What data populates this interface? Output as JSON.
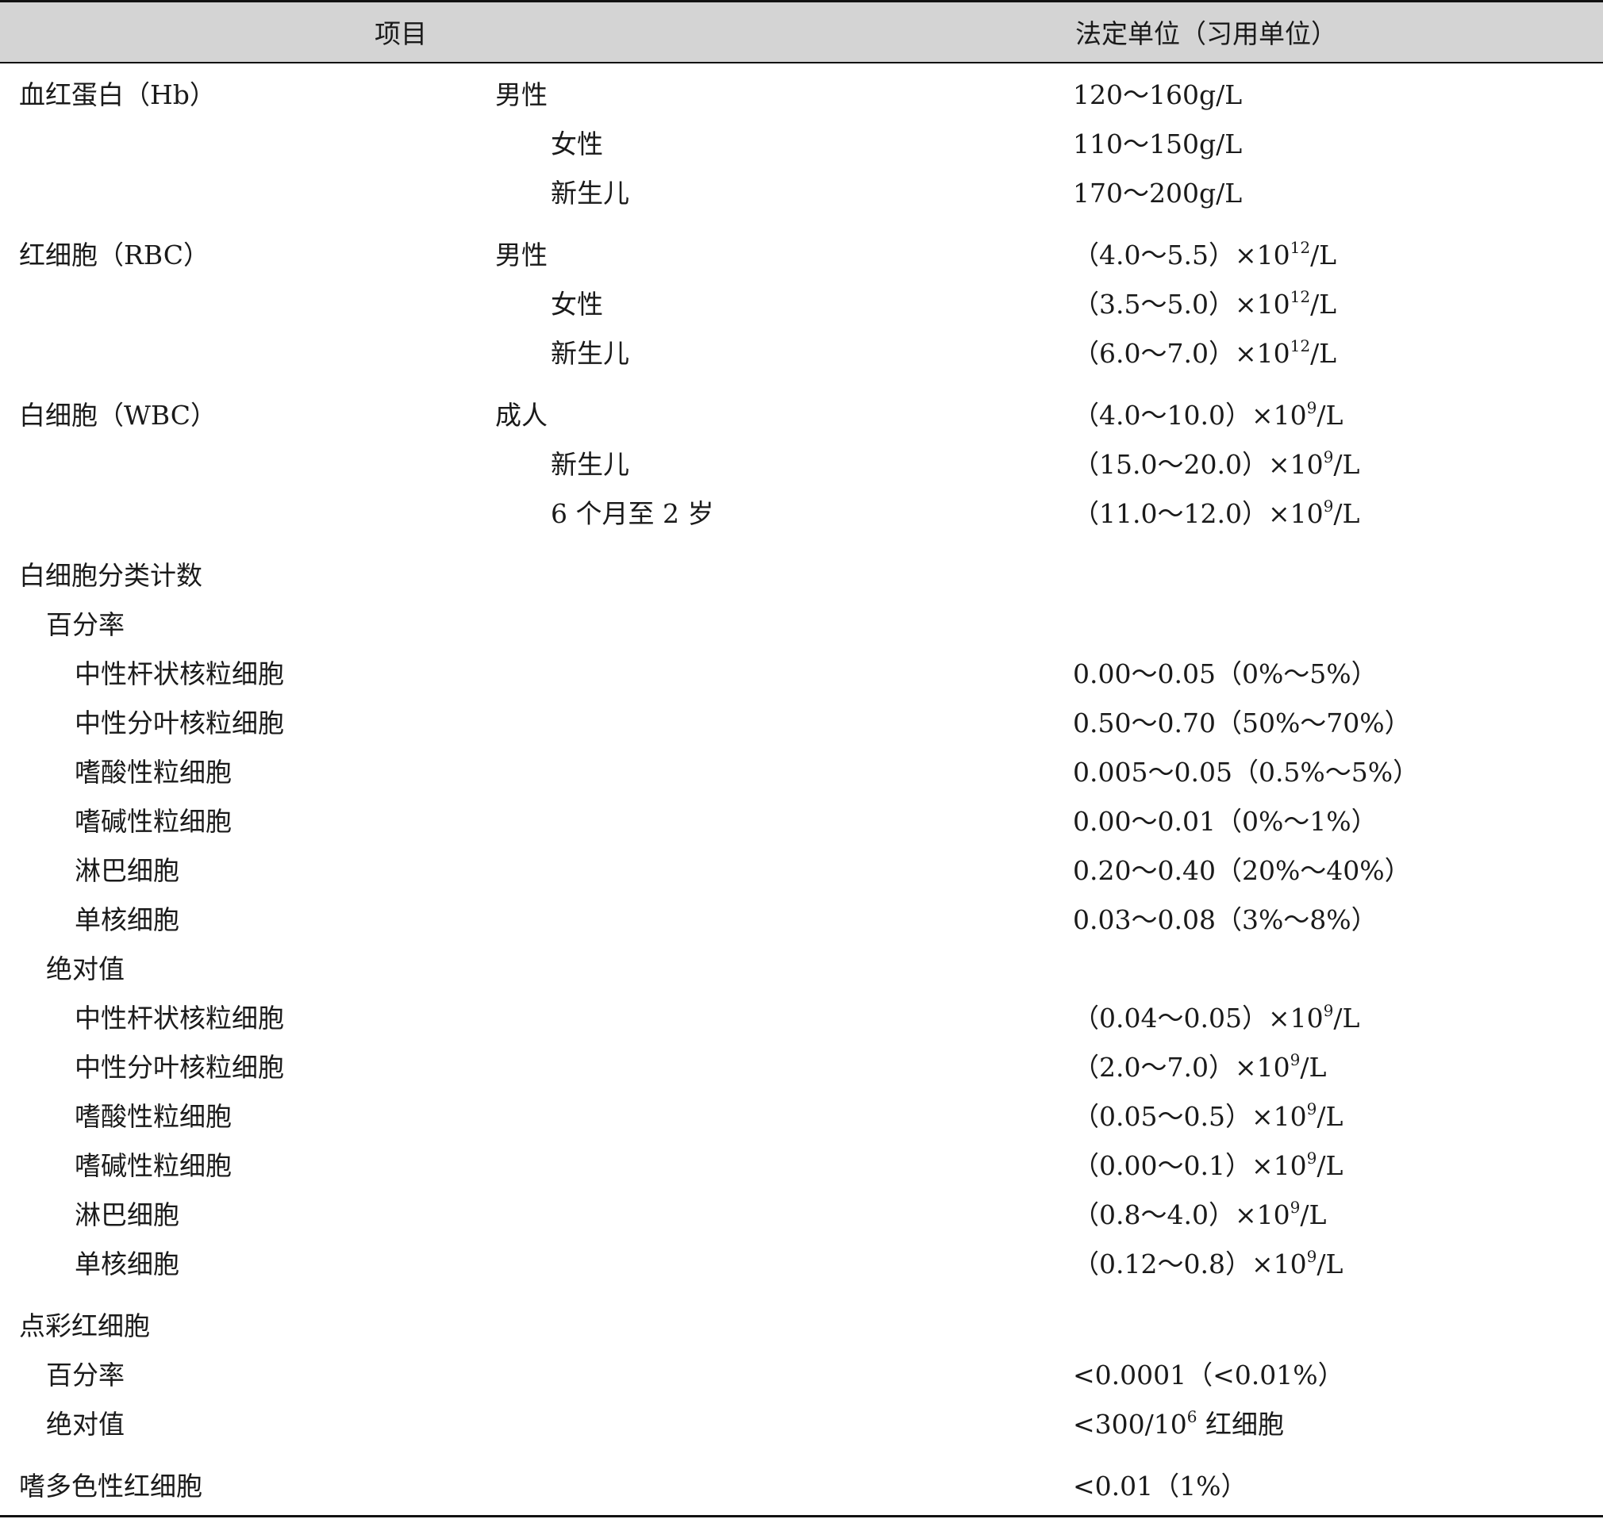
{
  "header": {
    "col_item": "项目",
    "col_unit": "法定单位（习用单位）"
  },
  "rows": [
    {
      "name": "血红蛋白（Hb）",
      "sub": "男性",
      "value": "120～160g/L"
    },
    {
      "name": "",
      "sub": "女性",
      "value": "110～150g/L"
    },
    {
      "name": "",
      "sub": "新生儿",
      "value": "170～200g/L"
    },
    {
      "name": "红细胞（RBC）",
      "sub": "男性",
      "value": "（4.0～5.5）×10",
      "exp": "12",
      "unit": "/L"
    },
    {
      "name": "",
      "sub": "女性",
      "value": "（3.5～5.0）×10",
      "exp": "12",
      "unit": "/L"
    },
    {
      "name": "",
      "sub": "新生儿",
      "value": "（6.0～7.0）×10",
      "exp": "12",
      "unit": "/L"
    },
    {
      "name": "白细胞（WBC）",
      "sub": "成人",
      "value": "（4.0～10.0）×10",
      "exp": "9",
      "unit": "/L"
    },
    {
      "name": "",
      "sub": "新生儿",
      "value": "（15.0～20.0）×10",
      "exp": "9",
      "unit": "/L"
    },
    {
      "name": "",
      "sub": "6 个月至 2 岁",
      "value": "（11.0～12.0）×10",
      "exp": "9",
      "unit": "/L"
    },
    {
      "name": "白细胞分类计数",
      "sub": "",
      "value": ""
    },
    {
      "name": "百分率",
      "sub": "",
      "value": ""
    },
    {
      "name": "中性杆状核粒细胞",
      "sub": "",
      "value": "0.00～0.05（0%～5%）"
    },
    {
      "name": "中性分叶核粒细胞",
      "sub": "",
      "value": "0.50～0.70（50%～70%）"
    },
    {
      "name": "嗜酸性粒细胞",
      "sub": "",
      "value": "0.005～0.05（0.5%～5%）"
    },
    {
      "name": "嗜碱性粒细胞",
      "sub": "",
      "value": "0.00～0.01（0%～1%）"
    },
    {
      "name": "淋巴细胞",
      "sub": "",
      "value": "0.20～0.40（20%～40%）"
    },
    {
      "name": "单核细胞",
      "sub": "",
      "value": "0.03～0.08（3%～8%）"
    },
    {
      "name": "绝对值",
      "sub": "",
      "value": ""
    },
    {
      "name": "中性杆状核粒细胞",
      "sub": "",
      "value": "（0.04～0.05）×10",
      "exp": "9",
      "unit": "/L"
    },
    {
      "name": "中性分叶核粒细胞",
      "sub": "",
      "value": "（2.0～7.0）×10",
      "exp": "9",
      "unit": "/L"
    },
    {
      "name": "嗜酸性粒细胞",
      "sub": "",
      "value": "（0.05～0.5）×10",
      "exp": "9",
      "unit": "/L"
    },
    {
      "name": "嗜碱性粒细胞",
      "sub": "",
      "value": "（0.00～0.1）×10",
      "exp": "9",
      "unit": "/L"
    },
    {
      "name": "淋巴细胞",
      "sub": "",
      "value": "（0.8～4.0）×10",
      "exp": "9",
      "unit": "/L"
    },
    {
      "name": "单核细胞",
      "sub": "",
      "value": "（0.12～0.8）×10",
      "exp": "9",
      "unit": "/L"
    },
    {
      "name": "点彩红细胞",
      "sub": "",
      "value": ""
    },
    {
      "name": "百分率",
      "sub": "",
      "value": "<0.0001（<0.01%）"
    },
    {
      "name": "绝对值",
      "sub": "",
      "value": "<300/10",
      "exp": "6",
      "unit": " 红细胞"
    },
    {
      "name": "嗜多色性红细胞",
      "sub": "",
      "value": "<0.01（1%）"
    }
  ]
}
